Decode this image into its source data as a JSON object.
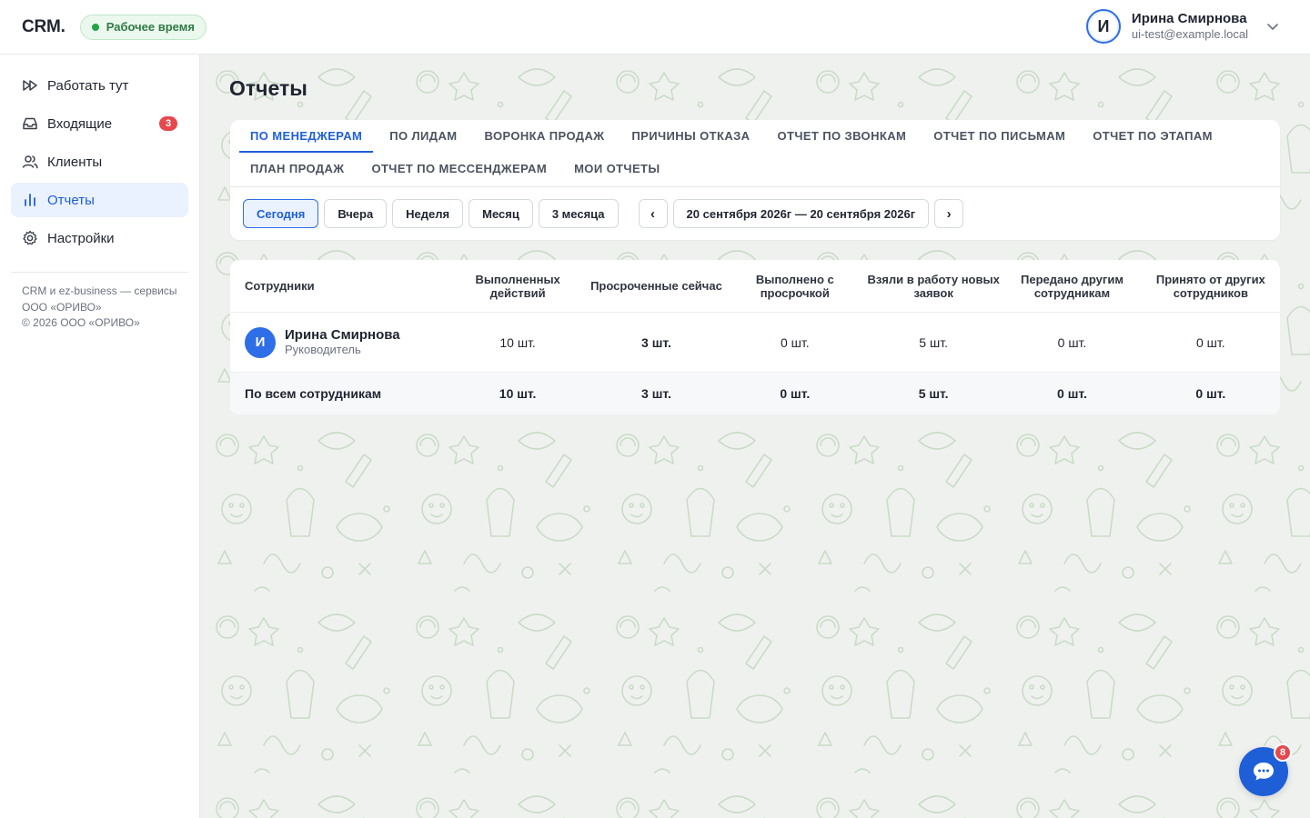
{
  "header": {
    "logo": "CRM.",
    "work_status": "Рабочее время",
    "user": {
      "initial": "И",
      "name": "Ирина Смирнова",
      "email": "ui-test@example.local"
    }
  },
  "sidebar": {
    "items": [
      {
        "label": "Работать тут",
        "icon": "fast-forward-icon"
      },
      {
        "label": "Входящие",
        "icon": "inbox-icon",
        "badge": "3"
      },
      {
        "label": "Клиенты",
        "icon": "users-icon"
      },
      {
        "label": "Отчеты",
        "icon": "bar-chart-icon",
        "active": true
      },
      {
        "label": "Настройки",
        "icon": "gear-icon"
      }
    ],
    "footer": [
      "CRM и ez-business — сервисы",
      "ООО «ОРИВО»",
      "© 2026 ООО «ОРИВО»"
    ]
  },
  "page": {
    "title": "Отчеты"
  },
  "tabs": [
    "По менеджерам",
    "По лидам",
    "Воронка продаж",
    "Причины отказа",
    "Отчет по звонкам",
    "Отчет по письмам",
    "Отчет по этапам",
    "План продаж",
    "Отчет по мессенджерам",
    "Мои отчеты"
  ],
  "active_tab": "По менеджерам",
  "filters": {
    "periods": [
      "Сегодня",
      "Вчера",
      "Неделя",
      "Месяц",
      "3 месяца"
    ],
    "active_period": "Сегодня",
    "prev": "‹",
    "next": "›",
    "date_range": "20 сентября 2026г — 20 сентября 2026г"
  },
  "table": {
    "headers": [
      "Сотрудники",
      "Выполненных действий",
      "Просроченные сейчас",
      "Выполнено с просрочкой",
      "Взяли в работу новых заявок",
      "Передано другим сотрудникам",
      "Принято от других сотрудников"
    ],
    "rows": [
      {
        "initial": "И",
        "name": "Ирина Смирнова",
        "role": "Руководитель",
        "values": [
          "10 шт.",
          "3 шт.",
          "0 шт.",
          "5 шт.",
          "0 шт.",
          "0 шт."
        ]
      }
    ],
    "total": {
      "label": "По всем сотрудникам",
      "values": [
        "10 шт.",
        "3 шт.",
        "0 шт.",
        "5 шт.",
        "0 шт.",
        "0 шт."
      ]
    }
  },
  "chat": {
    "badge": "8",
    "icon": "chat-bubble-icon"
  },
  "colors": {
    "accent": "#1e5fd8",
    "badge": "#e5484d",
    "status_green": "#22a447"
  }
}
